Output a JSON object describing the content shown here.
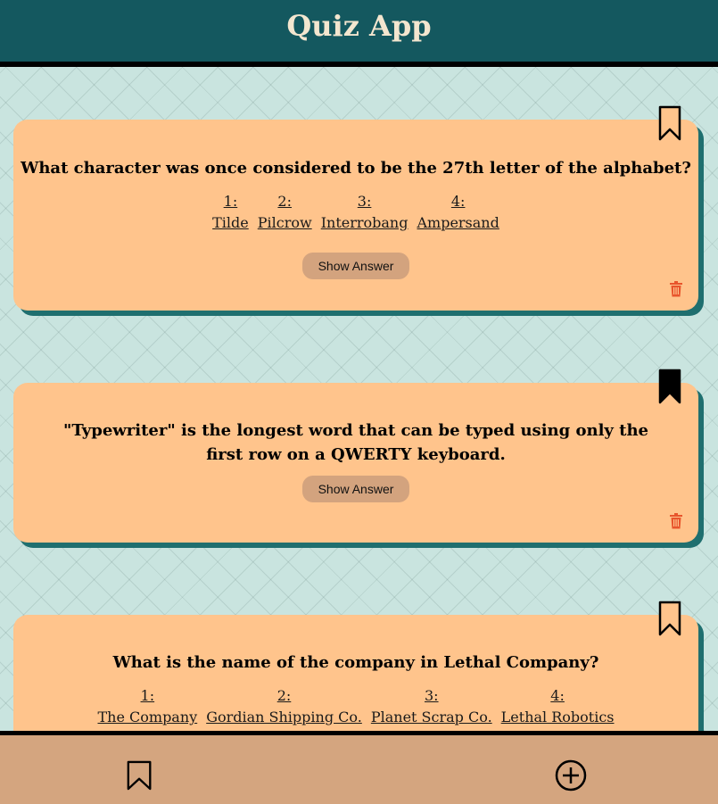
{
  "header": {
    "title": "Quiz App"
  },
  "cards": [
    {
      "question": "What character was once considered to be the 27th letter of the alphabet?",
      "answers": [
        {
          "num": "1:",
          "text": "Tilde"
        },
        {
          "num": "2:",
          "text": "Pilcrow"
        },
        {
          "num": "3:",
          "text": "Interrobang"
        },
        {
          "num": "4:",
          "text": "Ampersand"
        }
      ],
      "show_answer_label": "Show Answer",
      "bookmarked": false
    },
    {
      "question": "\"Typewriter\" is the longest word that can be typed using only the first row on a QWERTY keyboard.",
      "show_answer_label": "Show Answer",
      "bookmarked": true
    },
    {
      "question": "What is the name of the company in Lethal Company?",
      "answers": [
        {
          "num": "1:",
          "text": "The Company"
        },
        {
          "num": "2:",
          "text": "Gordian Shipping Co."
        },
        {
          "num": "3:",
          "text": "Planet Scrap Co."
        },
        {
          "num": "4:",
          "text": "Lethal Robotics"
        }
      ],
      "bookmarked": false
    }
  ],
  "footer": {
    "left_icon": "bookmark-icon",
    "right_icon": "add-circle-icon"
  },
  "colors": {
    "header_bg": "#14585f",
    "title_text": "#f3e6cf",
    "card_bg": "#ffc48c",
    "card_shadow": "#1f6f6f",
    "button_bg": "#d3a37e",
    "footer_bg": "#d4a57f",
    "trash_icon": "#e8552c"
  }
}
